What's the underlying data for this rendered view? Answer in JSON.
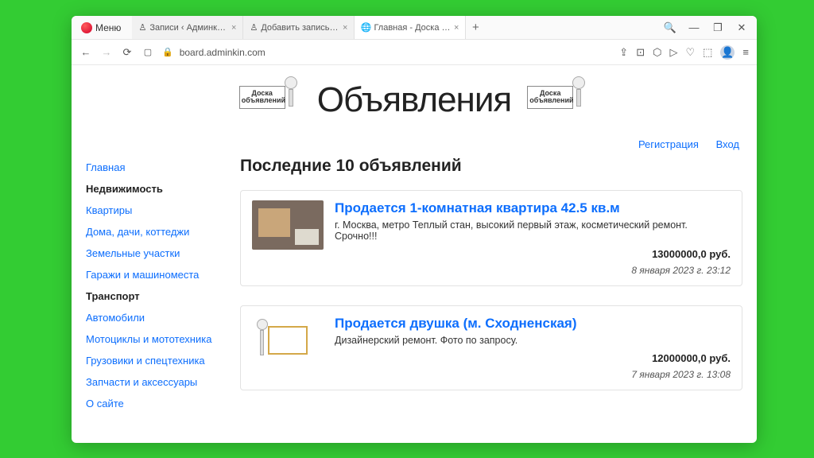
{
  "browser": {
    "menu_label": "Меню",
    "tabs": [
      {
        "title": "Записи ‹ Админкин — W…"
      },
      {
        "title": "Добавить запись ‹ Адми…"
      },
      {
        "title": "Главная - Доска объявле…"
      }
    ],
    "url": "board.adminkin.com"
  },
  "page": {
    "sign_text": "Доска\nобъявлений",
    "title": "Объявления",
    "user_links": {
      "register": "Регистрация",
      "login": "Вход"
    },
    "section_title": "Последние 10 объявлений"
  },
  "sidebar": {
    "items": [
      {
        "label": "Главная",
        "kind": "link"
      },
      {
        "label": "Недвижимость",
        "kind": "heading"
      },
      {
        "label": "Квартиры",
        "kind": "link"
      },
      {
        "label": "Дома, дачи, коттеджи",
        "kind": "link"
      },
      {
        "label": "Земельные участки",
        "kind": "link"
      },
      {
        "label": "Гаражи и машиноместа",
        "kind": "link"
      },
      {
        "label": "Транспорт",
        "kind": "heading"
      },
      {
        "label": "Автомобили",
        "kind": "link"
      },
      {
        "label": "Мотоциклы и мототехника",
        "kind": "link"
      },
      {
        "label": "Грузовики и спецтехника",
        "kind": "link"
      },
      {
        "label": "Запчасти и аксессуары",
        "kind": "link"
      },
      {
        "label": "О сайте",
        "kind": "link"
      }
    ]
  },
  "ads": [
    {
      "title": "Продается 1-комнатная квартира 42.5 кв.м",
      "desc": "г. Москва, метро Теплый стан, высокий первый этаж, косметический ремонт. Срочно!!!",
      "price": "13000000,0 руб.",
      "date": "8 января 2023 г. 23:12"
    },
    {
      "title": "Продается двушка (м. Сходненская)",
      "desc": "Дизайнерский ремонт. Фото по запросу.",
      "price": "12000000,0 руб.",
      "date": "7 января 2023 г. 13:08"
    }
  ]
}
